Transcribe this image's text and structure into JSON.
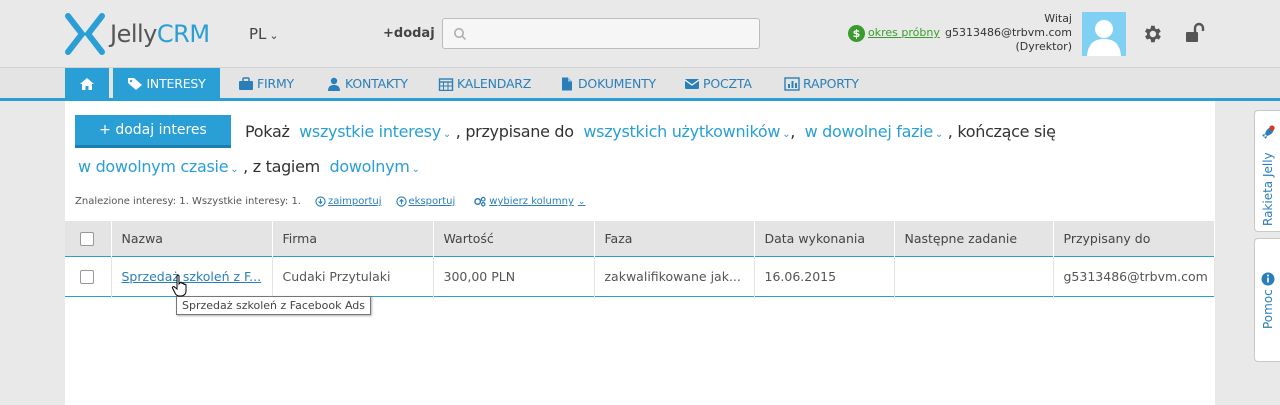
{
  "header": {
    "logo_text_a": "Jelly",
    "logo_text_b": "CRM",
    "language": "PL",
    "add_label": "+dodaj",
    "search_placeholder": "",
    "trial_link": "okres próbny",
    "greeting": "Witaj",
    "user_email": "g5313486@trbvm.com",
    "user_role": "(Dyrektor)"
  },
  "nav": {
    "items": [
      {
        "label": "INTERESY",
        "icon": "tag-icon"
      },
      {
        "label": "FIRMY",
        "icon": "briefcase-icon"
      },
      {
        "label": "KONTAKTY",
        "icon": "user-icon"
      },
      {
        "label": "KALENDARZ",
        "icon": "calendar-icon"
      },
      {
        "label": "DOKUMENTY",
        "icon": "document-icon"
      },
      {
        "label": "POCZTA",
        "icon": "envelope-icon"
      },
      {
        "label": "RAPORTY",
        "icon": "chart-icon"
      }
    ]
  },
  "toolbar": {
    "add_button": "+ dodaj interes",
    "show": "Pokaż",
    "filter_scope": "wszystkie interesy",
    "assigned_to_text": ", przypisane do",
    "filter_users": "wszystkich użytkowników",
    "comma": ",",
    "filter_phase": "w dowolnej fazie",
    "ending_text": ", kończące się",
    "filter_time": "w dowolnym czasie",
    "tag_text": ", z tagiem",
    "filter_tag": "dowolnym"
  },
  "summary": {
    "text": "Znalezione interesy: 1. Wszystkie interesy: 1.",
    "import": "zaimportuj",
    "export": "eksportuj",
    "columns": "wybierz kolumny"
  },
  "table": {
    "headers": [
      "Nazwa",
      "Firma",
      "Wartość",
      "Faza",
      "Data wykonania",
      "Następne zadanie",
      "Przypisany do"
    ],
    "rows": [
      {
        "name": "Sprzedaż szkoleń z F...",
        "company": "Cudaki Przytulaki",
        "value": "300,00 PLN",
        "phase": "zakwalifikowane jak...",
        "date": "16.06.2015",
        "next_task": "",
        "assigned": "g5313486@trbvm.com"
      }
    ]
  },
  "tooltip": "Sprzedaż szkoleń z Facebook Ads",
  "side_tabs": {
    "rocket": "Rakieta Jelly",
    "help": "Pomoc"
  },
  "colors": {
    "accent": "#2a9fd6",
    "trial_green": "#3a9c2e"
  }
}
